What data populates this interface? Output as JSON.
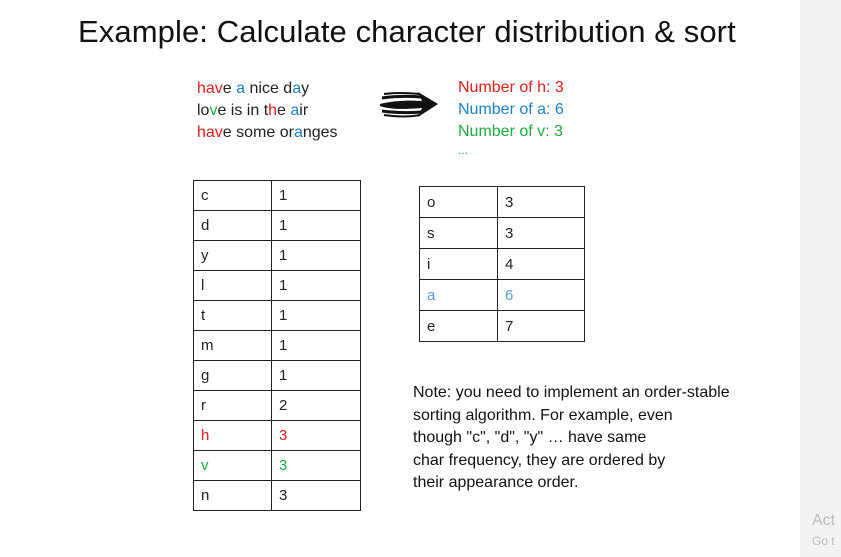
{
  "title": "Example: Calculate character distribution & sort",
  "source_lines": [
    [
      [
        "hav",
        "c-red"
      ],
      [
        "e ",
        ""
      ],
      [
        "a",
        "c-blue"
      ],
      [
        " nice d",
        ""
      ],
      [
        "a",
        "c-blue"
      ],
      [
        "y",
        ""
      ]
    ],
    [
      [
        "lo",
        ""
      ],
      [
        "v",
        "c-green"
      ],
      [
        "e is in t",
        ""
      ],
      [
        "h",
        "c-red"
      ],
      [
        "e ",
        ""
      ],
      [
        "a",
        "c-blue"
      ],
      [
        "ir",
        ""
      ]
    ],
    [
      [
        "hav",
        "c-red"
      ],
      [
        "e some or",
        ""
      ],
      [
        "a",
        "c-blue"
      ],
      [
        "nges",
        ""
      ]
    ]
  ],
  "counts": {
    "line1": "Number of h: 3",
    "line2": "Number of a: 6",
    "line3": "Number of v: 3",
    "ellipsis": "..."
  },
  "colors": {
    "red": "#e0201b",
    "blue": "#1f7fc8",
    "green": "#1faa3f",
    "light_blue": "#5b9bd5"
  },
  "left_table": [
    {
      "char": "c",
      "count": "1",
      "color": ""
    },
    {
      "char": "d",
      "count": "1",
      "color": ""
    },
    {
      "char": "y",
      "count": "1",
      "color": ""
    },
    {
      "char": "l",
      "count": "1",
      "color": ""
    },
    {
      "char": "t",
      "count": "1",
      "color": ""
    },
    {
      "char": "m",
      "count": "1",
      "color": ""
    },
    {
      "char": "g",
      "count": "1",
      "color": ""
    },
    {
      "char": "r",
      "count": "2",
      "color": ""
    },
    {
      "char": "h",
      "count": "3",
      "color": "c-red"
    },
    {
      "char": "v",
      "count": "3",
      "color": "c-green"
    },
    {
      "char": "n",
      "count": "3",
      "color": ""
    }
  ],
  "right_table": [
    {
      "char": "o",
      "count": "3",
      "color": ""
    },
    {
      "char": "s",
      "count": "3",
      "color": ""
    },
    {
      "char": "i",
      "count": "4",
      "color": ""
    },
    {
      "char": "a",
      "count": "6",
      "color": "c-lblue"
    },
    {
      "char": "e",
      "count": "7",
      "color": ""
    }
  ],
  "note": {
    "lines": [
      "Note: you need to implement an order-stable",
      "sorting algorithm. For example, even",
      "though \"c\", \"d\", \"y\" … have same",
      "char frequency, they are ordered by",
      "their appearance order."
    ]
  },
  "watermark": {
    "line1": "Act",
    "line2": "Go t"
  }
}
